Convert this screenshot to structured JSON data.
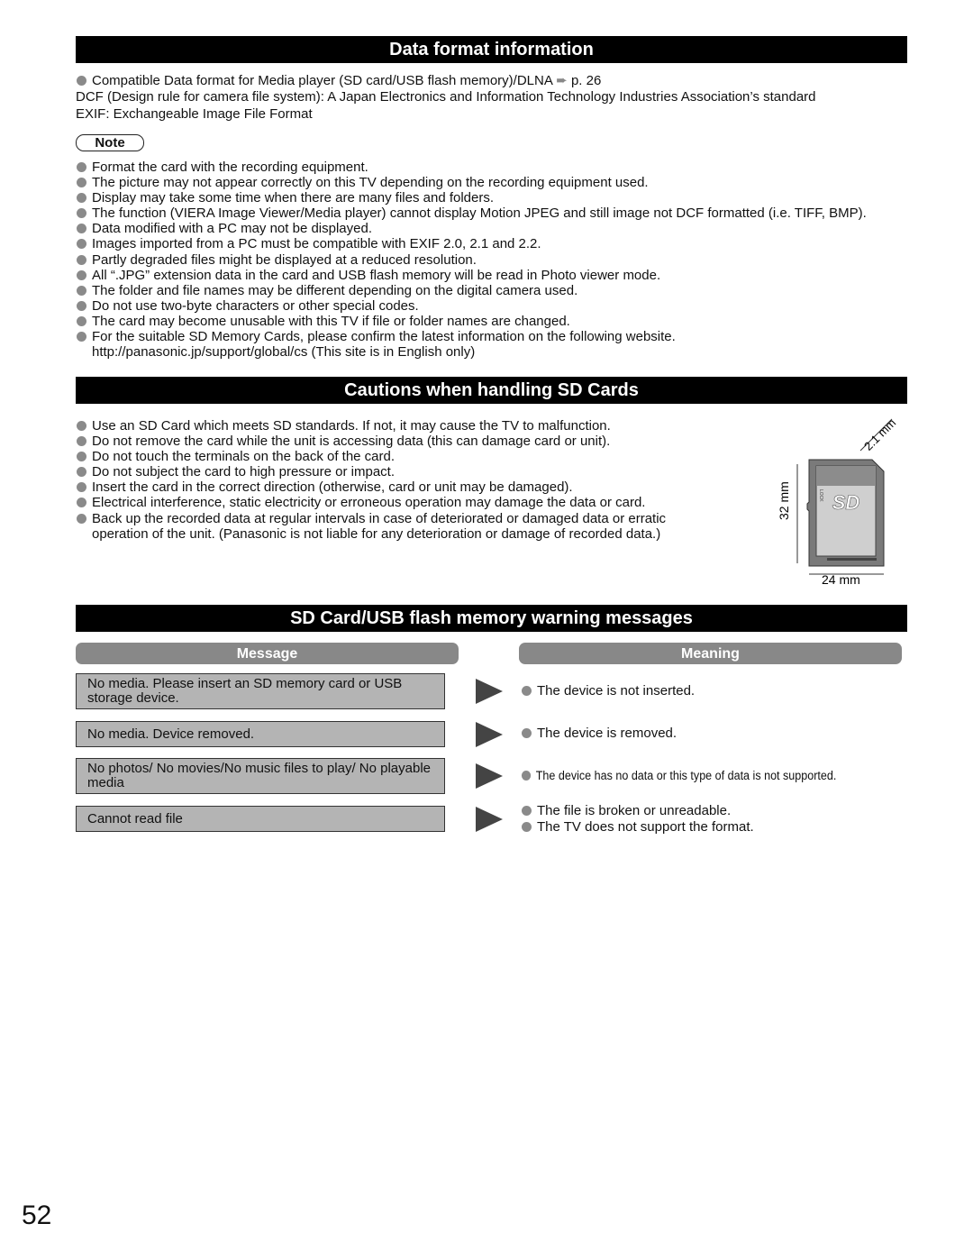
{
  "sections": {
    "data_format": {
      "title": "Data format information",
      "intro_bullet": "Compatible Data format for Media player (SD card/USB flash memory)/DLNA",
      "intro_ref": "p. 26",
      "dcf": "DCF (Design rule for camera file system): A Japan Electronics and Information Technology Industries Association’s standard",
      "exif": "EXIF: Exchangeable Image File Format",
      "note_label": "Note",
      "notes": [
        "Format the card with the recording equipment.",
        "The picture may not appear correctly on this TV depending on the recording equipment used.",
        "Display may take some time when there are many files and folders.",
        "The function (VIERA Image Viewer/Media player) cannot display Motion JPEG and still image not DCF formatted (i.e. TIFF, BMP).",
        "Data modified with a PC may not be displayed.",
        "Images imported from a PC must be compatible with EXIF 2.0, 2.1 and 2.2.",
        "Partly degraded files might be displayed at a reduced resolution.",
        "All “.JPG” extension data in the card and USB flash memory will be read in Photo viewer mode.",
        "The folder and file names may be different depending on the digital camera used.",
        "Do not use two-byte characters or other special codes.",
        "The card may become unusable with this TV if file or folder names are changed.",
        "For the suitable SD Memory Cards, please confirm the latest information on the following website."
      ],
      "website": "http://panasonic.jp/support/global/cs (This site is in English only)"
    },
    "cautions": {
      "title": "Cautions when handling SD Cards",
      "items": [
        "Use an SD Card which meets SD standards. If not, it may cause the TV to malfunction.",
        "Do not remove the card while the unit is accessing data (this can damage card or unit).",
        "Do not touch the terminals on the back of the card.",
        "Do not subject the card to high pressure or impact.",
        "Insert the card in the correct direction (otherwise, card or unit may be damaged).",
        "Electrical interference, static electricity or erroneous operation may damage the data or card.",
        "Back up the recorded data at regular intervals in case of deteriorated or damaged data or erratic operation of the unit. (Panasonic is not liable for any deterioration or damage of recorded data.)"
      ],
      "figure": {
        "thickness": "2.1 mm",
        "height": "32 mm",
        "width": "24 mm",
        "logo": "SD",
        "lock": "LOCK"
      }
    },
    "warnings": {
      "title": "SD Card/USB flash memory warning messages",
      "col_message": "Message",
      "col_meaning": "Meaning",
      "rows": [
        {
          "message": "No media. Please insert an SD memory card or USB storage device.",
          "meanings": [
            "The device is not inserted."
          ]
        },
        {
          "message": "No media. Device removed.",
          "meanings": [
            "The device is removed."
          ]
        },
        {
          "message": "No photos/ No movies/No music files to play/ No playable media",
          "meanings": [
            "The device has no data or this type of data is not supported."
          ]
        },
        {
          "message": "Cannot read file",
          "meanings": [
            "The file is broken or unreadable.",
            "The TV does not support the format."
          ]
        }
      ]
    }
  },
  "page_number": "52"
}
